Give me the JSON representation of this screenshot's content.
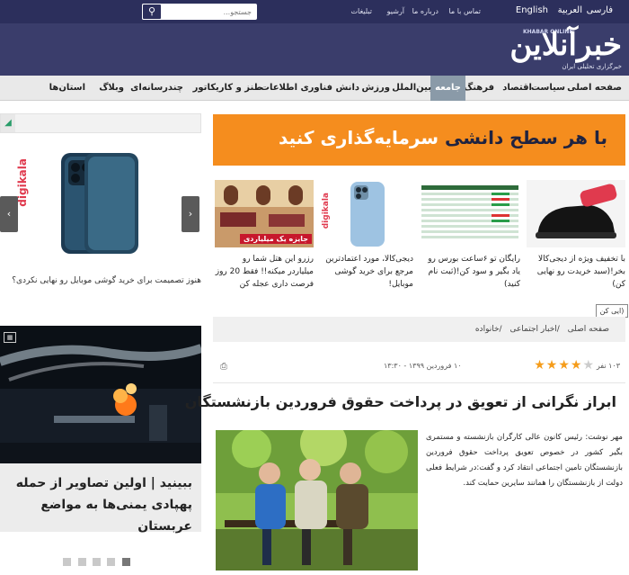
{
  "topbar": {
    "langs": [
      "فارسی",
      "العربية",
      "English"
    ],
    "links": [
      "تماس با ما",
      "درباره ما",
      "آرشیو",
      "تبلیغات"
    ],
    "search_placeholder": "جستجو..."
  },
  "logo": {
    "main": "خبرآنلاین",
    "en": "KHABAR ONLINE",
    "tagline": "خبرگزاری تحلیلی ایران"
  },
  "nav": {
    "items": [
      "صفحه اصلی",
      "سیاست",
      "اقتصاد",
      "فرهنگ",
      "جامعه",
      "بین‌الملل",
      "ورزش",
      "دانش",
      "فناوری اطلاعات",
      "طنز و کاریکاتور",
      "چندرسانه‌ای",
      "وبلاگ",
      "استان‌ها"
    ],
    "active": "جامعه"
  },
  "ad_banner": {
    "text_a": "با هر سطح دانشی",
    "text_b": "سرمایه‌گذاری کنید"
  },
  "cards": [
    {
      "title": "با تخفیف ویژه از دیجی‌کالا بخر!(سبد خریدت رو نهایی کن)",
      "img": "shoe"
    },
    {
      "title": "رایگان تو ۶ساعت بورس رو یاد بگیر و سود کن!(ثبت نام کنید)",
      "img": "stocks"
    },
    {
      "title": "دیجی‌کالا، مورد اعتمادترین مرجع برای خرید گوشی موبایل!",
      "img": "phone",
      "brand": "digikala"
    },
    {
      "title": "رزرو این هتل شما رو میلیاردر میکنه!! فقط 20 روز فرصت داری عجله کن",
      "img": "hotel",
      "badge": "جایزه یک میلیاردی"
    }
  ],
  "side_ad": {
    "brand": "digikala",
    "caption": "هنوز تصمیمت برای خرید گوشی موبایل رو نهایی نکردی؟"
  },
  "tooltip": "ایی کن)",
  "breadcrumb": [
    "صفحه اصلی",
    "/اخبار اجتماعی",
    "/خانواده"
  ],
  "article": {
    "rating_count": "۱۰۳ نفر",
    "stars": 4,
    "date": "۱۰ فروردین ۱۳۹۹ - ۱۳:۳۰",
    "headline": "ابراز نگرانی از تعویق در پرداخت حقوق فروردین بازنشستگان",
    "body": "مهر نوشت: رئیس کانون عالی کارگران بازنشسته و مستمری بگیر کشور در خصوص تعویق پرداخت حقوق فروردین بازنشستگان تامین اجتماعی انتقاد کرد و گفت:در شرایط فعلی دولت از بازنشستگان را همانند سایرین حمایت کند."
  },
  "photo_news": {
    "caption": "ببینید | اولین تصاویر از حمله پهپادی یمنی‌ها به مواضع عربستان"
  },
  "slider_dots": 5,
  "colors": {
    "topbar": "#2c2f5c",
    "header": "#3a3d6b",
    "accent_orange": "#f58d1e",
    "star": "#f59c1a",
    "digikala": "#e03a4e"
  }
}
